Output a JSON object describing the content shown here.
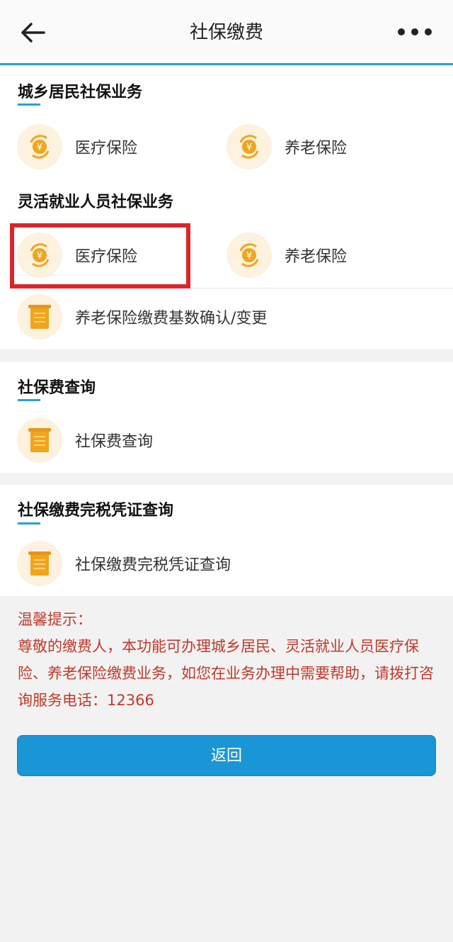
{
  "header": {
    "title": "社保缴费"
  },
  "section1": {
    "title": "城乡居民社保业务",
    "items": [
      {
        "label": "医疗保险",
        "icon": "coin-icon"
      },
      {
        "label": "养老保险",
        "icon": "coin-icon"
      }
    ]
  },
  "section2": {
    "title": "灵活就业人员社保业务",
    "items": [
      {
        "label": "医疗保险",
        "icon": "coin-icon"
      },
      {
        "label": "养老保险",
        "icon": "coin-icon"
      },
      {
        "label": "养老保险缴费基数确认/变更",
        "icon": "document-icon"
      }
    ]
  },
  "section3": {
    "title": "社保费查询",
    "items": [
      {
        "label": "社保费查询",
        "icon": "document-icon"
      }
    ]
  },
  "section4": {
    "title": "社保缴费完税凭证查询",
    "items": [
      {
        "label": "社保缴费完税凭证查询",
        "icon": "document-icon"
      }
    ]
  },
  "tips": {
    "heading": "温馨提示：",
    "body": "尊敬的缴费人，本功能可办理城乡居民、灵活就业人员医疗保险、养老保险缴费业务，如您在业务办理中需要帮助，请拨打咨询服务电话：12366"
  },
  "button": {
    "label": "返回"
  },
  "colors": {
    "accent": "#2a9fd6",
    "button": "#1a96d6",
    "tip_text": "#c0392b",
    "highlight": "#d9262a",
    "icon_bg": "#fdf1df",
    "coin": "#f0a51e"
  }
}
